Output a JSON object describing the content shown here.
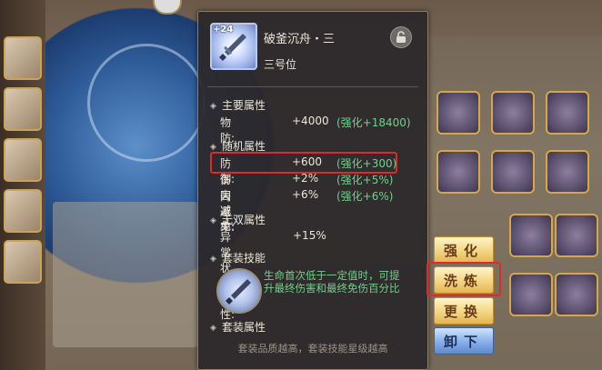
{
  "item": {
    "level": "+24",
    "name": "破釜沉舟・三",
    "position": "三号位"
  },
  "main_attr": {
    "title": "主要属性",
    "rows": [
      {
        "label": "物　防:",
        "value": "+4000",
        "bonus": "(强化+18400)"
      }
    ]
  },
  "random_attr": {
    "title": "随机属性",
    "rows": [
      {
        "label": "防　御:",
        "value": "+600",
        "bonus": "(强化+300)"
      },
      {
        "label": "伤害减免:",
        "value": "+2%",
        "bonus": "(强化+5%)"
      },
      {
        "label": "闪避率:",
        "value": "+6%",
        "bonus": "(强化+6%)"
      }
    ]
  },
  "unique_attr": {
    "title": "无双属性",
    "rows": [
      {
        "label": "异常状态抗性:",
        "value": "+15%"
      }
    ]
  },
  "set_skill": {
    "title": "套装技能",
    "desc": "生命首次低于一定值时，可提升最终伤害和最终免伤百分比"
  },
  "set_attr": {
    "title": "套装属性"
  },
  "footer": "套装品质越高，套装技能星级越高",
  "buttons": {
    "strengthen": "强化",
    "refine": "洗炼",
    "replace": "更换",
    "unequip": "卸下"
  },
  "colors": {
    "bonus_green": "#6fd08a",
    "highlight_red": "#e02a2a"
  }
}
